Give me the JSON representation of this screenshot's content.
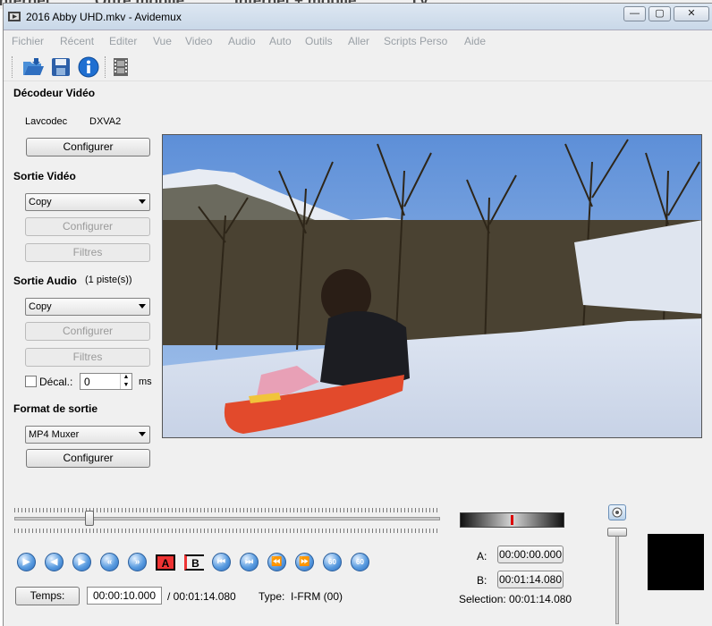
{
  "background_strip": [
    "Internet",
    "Offre mobile",
    "Internet + mobile",
    "TV"
  ],
  "window": {
    "title": "2016 Abby UHD.mkv - Avidemux",
    "controls": {
      "minimize": "—",
      "maximize": "▢",
      "close": "✕"
    }
  },
  "menu": [
    "Fichier",
    "Récent",
    "Editer",
    "Vue",
    "Video",
    "Audio",
    "Auto",
    "Outils",
    "Aller",
    "Scripts Perso",
    "Aide"
  ],
  "toolbar": {
    "icons": [
      "open-folder-icon",
      "save-disk-icon",
      "info-icon",
      "film-strip-icon"
    ]
  },
  "video_decoder": {
    "heading": "Décodeur Vidéo",
    "codec": "Lavcodec",
    "accel": "DXVA2",
    "configure": "Configurer"
  },
  "video_output": {
    "heading": "Sortie Vidéo",
    "selected": "Copy",
    "configure": "Configurer",
    "filters": "Filtres"
  },
  "audio_output": {
    "heading": "Sortie Audio",
    "tracks": "(1 piste(s))",
    "selected": "Copy",
    "configure": "Configurer",
    "filters": "Filtres",
    "shift_label": "Décal.:",
    "shift_value": "0",
    "shift_unit": "ms"
  },
  "output_format": {
    "heading": "Format de sortie",
    "selected": "MP4 Muxer",
    "configure": "Configurer"
  },
  "playback": {
    "seek_position": 0.17,
    "nav_icons": [
      "play-icon",
      "previous-frame-icon",
      "next-frame-icon",
      "previous-keyframe-icon",
      "next-keyframe-icon",
      "set-marker-a-icon",
      "set-marker-b-icon",
      "previous-cut-icon",
      "next-cut-icon",
      "go-to-start-icon",
      "go-to-end-icon",
      "back-60s-icon",
      "forward-60s-icon"
    ],
    "marker_a": "A",
    "marker_b": "B",
    "time_button": "Temps:",
    "current_time": "00:00:10.000",
    "total_time": "/ 00:01:14.080",
    "frame_type": "Type:  I-FRM (00)"
  },
  "selection": {
    "a_label": "A:",
    "a_value": "00:00:00.000",
    "b_label": "B:",
    "b_value": "00:01:14.080",
    "selection": "Selection: 00:01:14.080"
  },
  "colors": {
    "accent": "#3a86d6",
    "marker_red": "#d00000",
    "title_bar": "#c9d8e8"
  }
}
